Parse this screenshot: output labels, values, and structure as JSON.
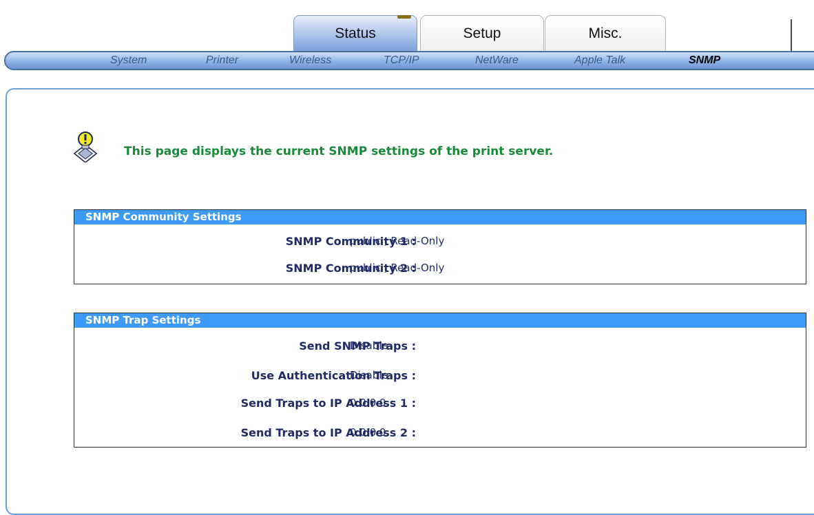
{
  "tabs": [
    {
      "label": "Status",
      "active": true
    },
    {
      "label": "Setup",
      "active": false
    },
    {
      "label": "Misc.",
      "active": false
    }
  ],
  "subnav": [
    {
      "label": "System",
      "active": false
    },
    {
      "label": "Printer",
      "active": false
    },
    {
      "label": "Wireless",
      "active": false
    },
    {
      "label": "TCP/IP",
      "active": false
    },
    {
      "label": "NetWare",
      "active": false
    },
    {
      "label": "Apple Talk",
      "active": false
    },
    {
      "label": "SNMP",
      "active": true
    }
  ],
  "hint": {
    "icon": "lightbulb-hint-icon",
    "text": "This page displays the current SNMP settings of the print server."
  },
  "community": {
    "header": "SNMP Community Settings",
    "rows": [
      {
        "label": "SNMP Community 1 :",
        "value": "public , Read-Only"
      },
      {
        "label": "SNMP Community 2 :",
        "value": "public , Read-Only"
      }
    ]
  },
  "trap": {
    "header": "SNMP Trap Settings",
    "rows": [
      {
        "label": "Send SNMP Traps :",
        "value": "Disable"
      },
      {
        "label": "Use Authentication Traps :",
        "value": "Disable"
      },
      {
        "label": "Send Traps to IP Address 1 :",
        "value": "0.0.0.0"
      },
      {
        "label": "Send Traps to IP Address 2 :",
        "value": "0.0.0.0"
      }
    ]
  },
  "colors": {
    "accent": "#3d9af5",
    "hint_text": "#1a8a3a",
    "label_text": "#1e2b66"
  }
}
